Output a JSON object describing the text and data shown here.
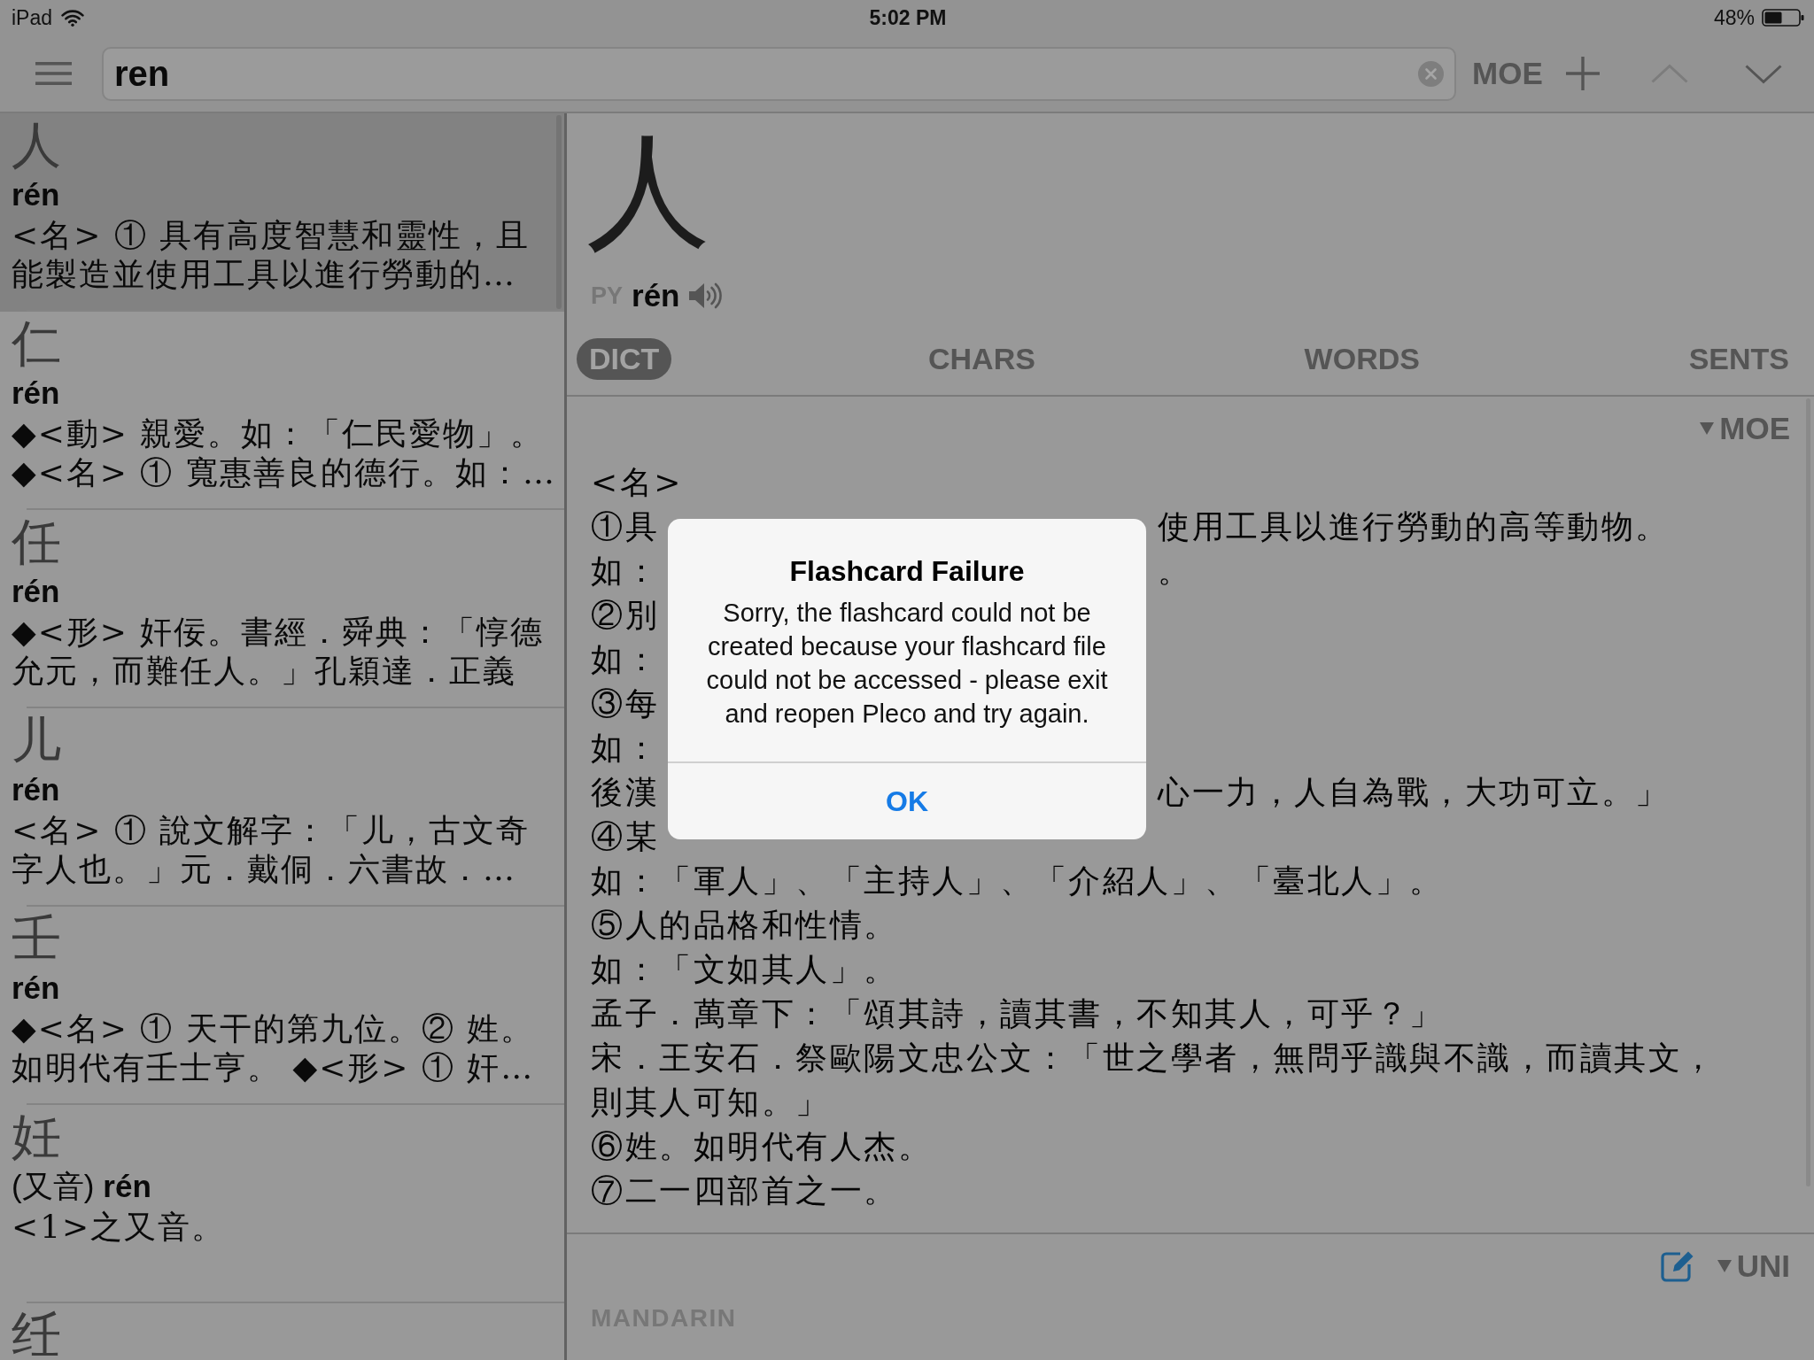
{
  "status_bar": {
    "carrier": "iPad",
    "time": "5:02 PM",
    "battery": "48%"
  },
  "toolbar": {
    "search": {
      "value": "ren"
    },
    "dictionary": "MOE",
    "arrows": [
      {
        "kind": "up",
        "disabled": true
      },
      {
        "kind": "down",
        "disabled": false
      }
    ]
  },
  "results": [
    {
      "headword": "人",
      "pinyin": "rén",
      "lines": [
        "<名> ① 具有高度智慧和靈性，且",
        "能製造並使用工具以進行勞動的…"
      ],
      "selected": true
    },
    {
      "headword": "仁",
      "pinyin": "rén",
      "lines": [
        "◆<動> 親愛。如：「仁民愛物」。",
        "◆<名> ① 寬惠善良的德行。如：…"
      ],
      "selected": false
    },
    {
      "headword": "任",
      "pinyin": "rén",
      "lines": [
        "◆<形> 奸佞。書經．舜典：「惇德",
        "允元，而難任人。」孔穎達．正義"
      ],
      "selected": false
    },
    {
      "headword": "儿",
      "pinyin": "rén",
      "lines": [
        "<名> ① 說文解字：「儿，古文奇",
        "字人也。」元．戴侗．六書故．…"
      ],
      "selected": false
    },
    {
      "headword": "壬",
      "pinyin": "rén",
      "lines": [
        "◆<名> ① 天干的第九位。② 姓。",
        "如明代有壬士亨。 ◆<形> ① 奸…"
      ],
      "selected": false
    },
    {
      "headword": "妊",
      "variant_note": "(又音)",
      "pinyin": "rén",
      "lines": [
        "<1>之又音。"
      ],
      "selected": false
    },
    {
      "headword": "纴",
      "selected": false
    }
  ],
  "entry": {
    "headword": "人",
    "pinyin_label": "PY",
    "pinyin": "rén",
    "tabs": [
      {
        "label": "DICT",
        "selected": true
      },
      {
        "label": "CHARS",
        "selected": false
      },
      {
        "label": "WORDS",
        "selected": false
      },
      {
        "label": "SENTS",
        "selected": false
      }
    ],
    "dictionary": "MOE",
    "part_of_speech": "<名>",
    "lines": [
      {
        "left": "①具",
        "right": "使用工具以進行勞動的高等動物。"
      },
      {
        "left": "如：",
        "right": "。"
      },
      {
        "left": "②別"
      },
      {
        "left": "如："
      },
      {
        "left": "③每"
      },
      {
        "left": "如："
      },
      {
        "left": "後漢",
        "right": "心一力，人自為戰，大功可立。」"
      },
      {
        "left": "④某"
      },
      {
        "text": "如：「軍人」、「主持人」、「介紹人」、「臺北人」。"
      },
      {
        "text": "⑤人的品格和性情。"
      },
      {
        "text": "如：「文如其人」。"
      },
      {
        "text": "孟子．萬章下：「頌其詩，讀其書，不知其人，可乎？」"
      },
      {
        "text": "宋．王安石．祭歐陽文忠公文：「世之學者，無問乎識與不識，而讀其文，則其人可知。」"
      },
      {
        "text": "⑥姓。如明代有人杰。"
      },
      {
        "text": "⑦二一四部首之一。"
      }
    ],
    "footer": {
      "dictionary": "UNI",
      "section": "MANDARIN"
    }
  },
  "alert": {
    "title": "Flashcard Failure",
    "message": "Sorry, the flashcard could not be created because your flashcard file could not be accessed - please exit and reopen Pleco and try again.",
    "button": "OK"
  }
}
